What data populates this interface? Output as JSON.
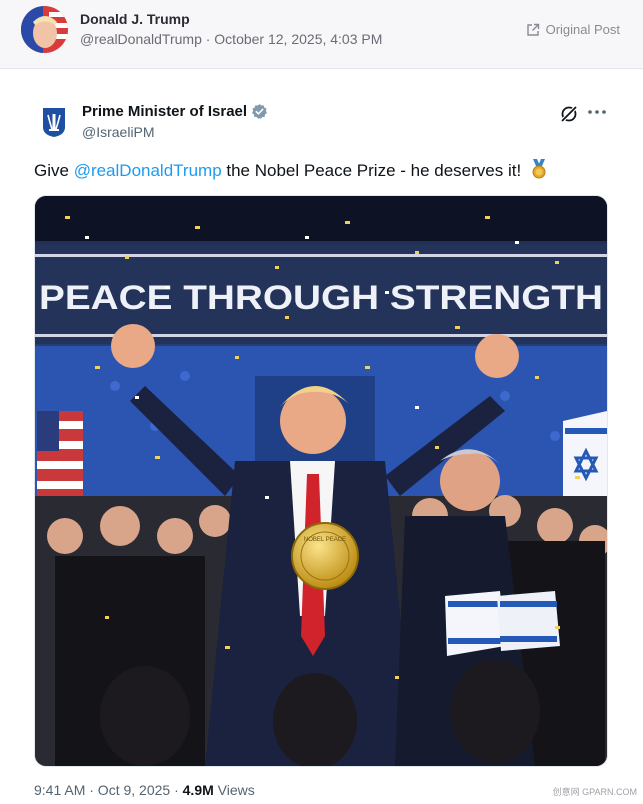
{
  "header": {
    "name": "Donald J. Trump",
    "subline": "@realDonaldTrump · October 12, 2025, 4:03 PM",
    "original_post_label": "Original Post"
  },
  "tweet": {
    "author_name": "Prime Minister of Israel",
    "handle": "@IsraeliPM",
    "text_before": "Give ",
    "mention": "@realDonaldTrump",
    "text_after": " the Nobel Peace Prize - he deserves it!",
    "footer_time": "9:41 AM · Oct 9, 2025 · ",
    "views_count": "4.9M",
    "views_label": " Views"
  },
  "photo": {
    "banner_text": "PEACE THROUGH STRENGTH",
    "medal_text": "NOBEL PEACE"
  },
  "watermark": {
    "text": "创意网 GPARN.COM"
  },
  "colors": {
    "accent": "#1d9bf0",
    "verified": "#829aab",
    "banner_blue": "#24335a"
  }
}
